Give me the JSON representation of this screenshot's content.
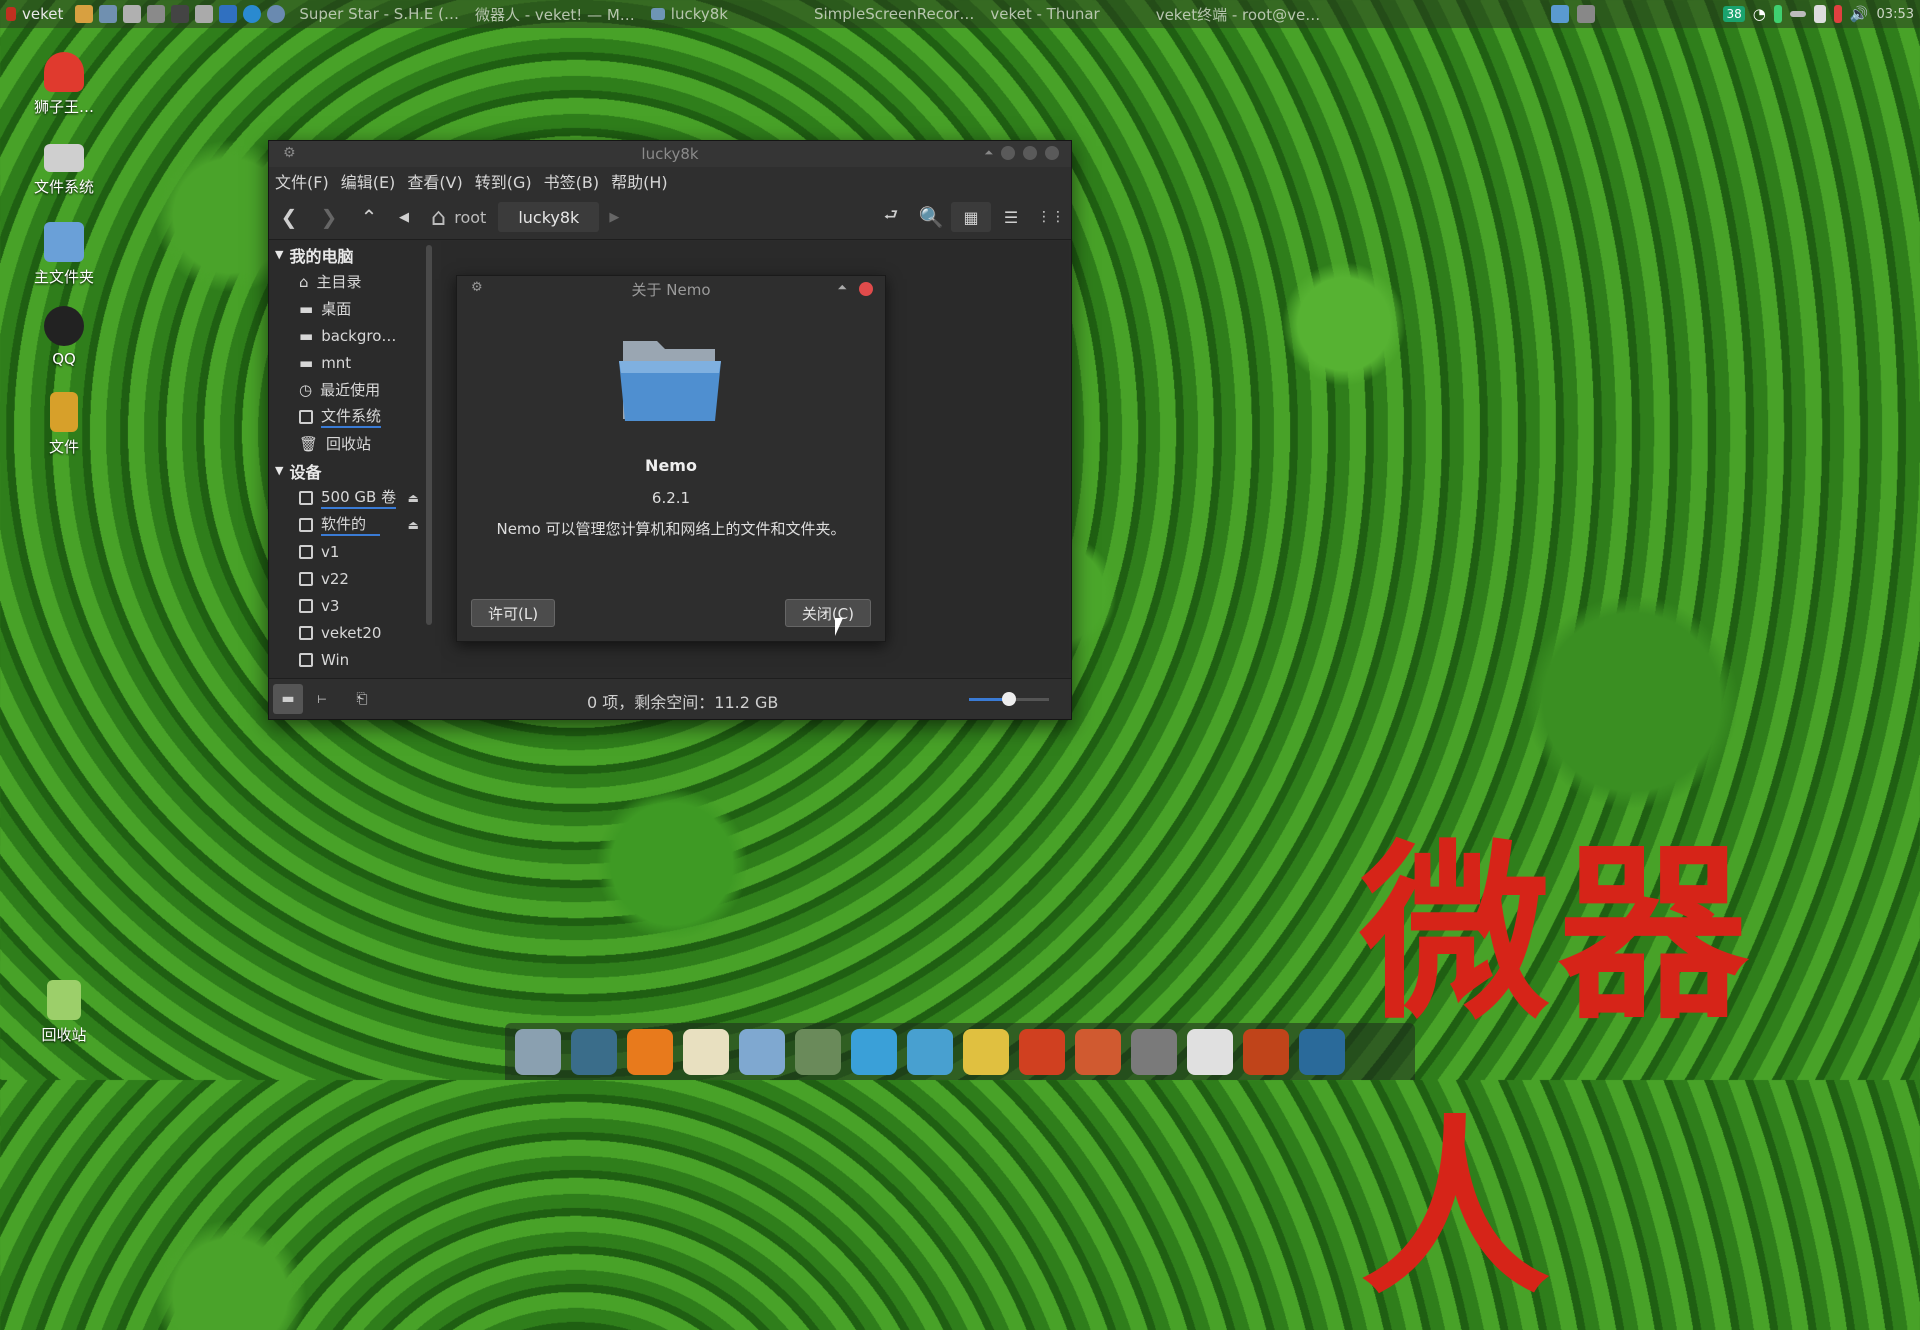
{
  "top_panel": {
    "app_name": "veket",
    "tasks": [
      "Super Star - S.H.E (…",
      "微器人 - veket! — M…",
      "lucky8k",
      "SimpleScreenRecor…",
      "veket - Thunar",
      "veket终端 - root@ve…"
    ],
    "badge": "38",
    "clock": "03:53"
  },
  "desktop_icons": [
    {
      "label": "狮子王…",
      "color": "#e03a2e"
    },
    {
      "label": "文件系统",
      "color": "#cfcfcf"
    },
    {
      "label": "主文件夹",
      "color": "#6aa0d8"
    },
    {
      "label": "QQ",
      "color": "#222222"
    },
    {
      "label": "文件",
      "color": "#d7a02a"
    },
    {
      "label": "回收站",
      "color": "#9ccf6a"
    }
  ],
  "window": {
    "title": "lucky8k",
    "menu": [
      "文件(F)",
      "编辑(E)",
      "查看(V)",
      "转到(G)",
      "书签(B)",
      "帮助(H)"
    ],
    "breadcrumb": {
      "root": "root",
      "current": "lucky8k"
    },
    "sidebar": {
      "section_computer": "我的电脑",
      "computer_items": [
        "主目录",
        "桌面",
        "backgro…",
        "mnt",
        "最近使用",
        "文件系统",
        "回收站"
      ],
      "section_devices": "设备",
      "device_items": [
        "500 GB 卷",
        "软件的",
        "v1",
        "v22",
        "v3",
        "veket20",
        "Win"
      ]
    },
    "status": "0 项，剩余空间：11.2 GB",
    "zoom_level": 0.5
  },
  "dialog": {
    "title": "关于 Nemo",
    "app_name": "Nemo",
    "version": "6.2.1",
    "description": "Nemo 可以管理您计算机和网络上的文件和文件夹。",
    "license_button": "许可(L)",
    "close_button": "关闭(C)"
  },
  "overlay_text": "微器人",
  "dock_apps": [
    {
      "name": "file-manager",
      "color": "#8aa0b0"
    },
    {
      "name": "terminal-monitor",
      "color": "#3a6d8a"
    },
    {
      "name": "firefox",
      "color": "#e87a1c"
    },
    {
      "name": "text-editor",
      "color": "#e8e0c0"
    },
    {
      "name": "image-viewer",
      "color": "#7fa8d0"
    },
    {
      "name": "network",
      "color": "#6a8a5a"
    },
    {
      "name": "atom-app",
      "color": "#3aa0d8"
    },
    {
      "name": "media-player",
      "color": "#48a0d0"
    },
    {
      "name": "notes",
      "color": "#e0c040"
    },
    {
      "name": "presentation",
      "color": "#d04020"
    },
    {
      "name": "rocket-launcher",
      "color": "#d05a30"
    },
    {
      "name": "drive",
      "color": "#7a7a7a"
    },
    {
      "name": "settings-sun",
      "color": "#e0e0e0"
    },
    {
      "name": "firefox-alt",
      "color": "#c0441a"
    },
    {
      "name": "browser-globe",
      "color": "#2a6a9a"
    }
  ]
}
